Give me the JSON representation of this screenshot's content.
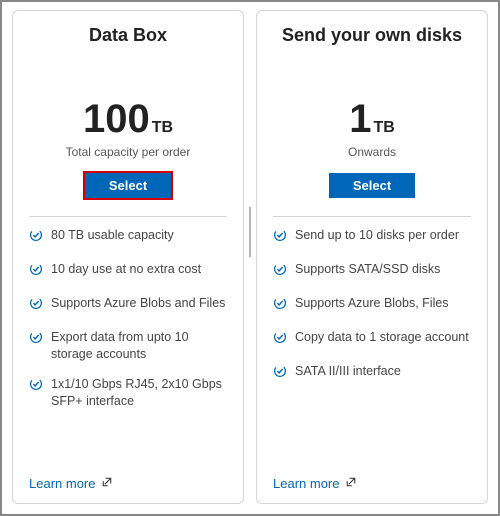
{
  "cards": [
    {
      "title": "Data Box",
      "capacity_value": "100",
      "capacity_unit": "TB",
      "capacity_sub": "Total capacity per order",
      "select_label": "Select",
      "highlighted": true,
      "features": [
        "80 TB usable capacity",
        "10 day use at no extra cost",
        "Supports Azure Blobs and Files",
        "Export data from upto 10 storage accounts",
        "1x1/10 Gbps RJ45, 2x10 Gbps SFP+ interface"
      ],
      "learn_more": "Learn more"
    },
    {
      "title": "Send your own disks",
      "capacity_value": "1",
      "capacity_unit": "TB",
      "capacity_sub": "Onwards",
      "select_label": "Select",
      "highlighted": false,
      "features": [
        "Send up to 10 disks per order",
        "Supports SATA/SSD disks",
        "Supports Azure Blobs, Files",
        "Copy data to 1 storage account",
        "SATA II/III interface"
      ],
      "learn_more": "Learn more"
    }
  ],
  "colors": {
    "accent": "#0067b8",
    "highlight": "#d40000"
  }
}
